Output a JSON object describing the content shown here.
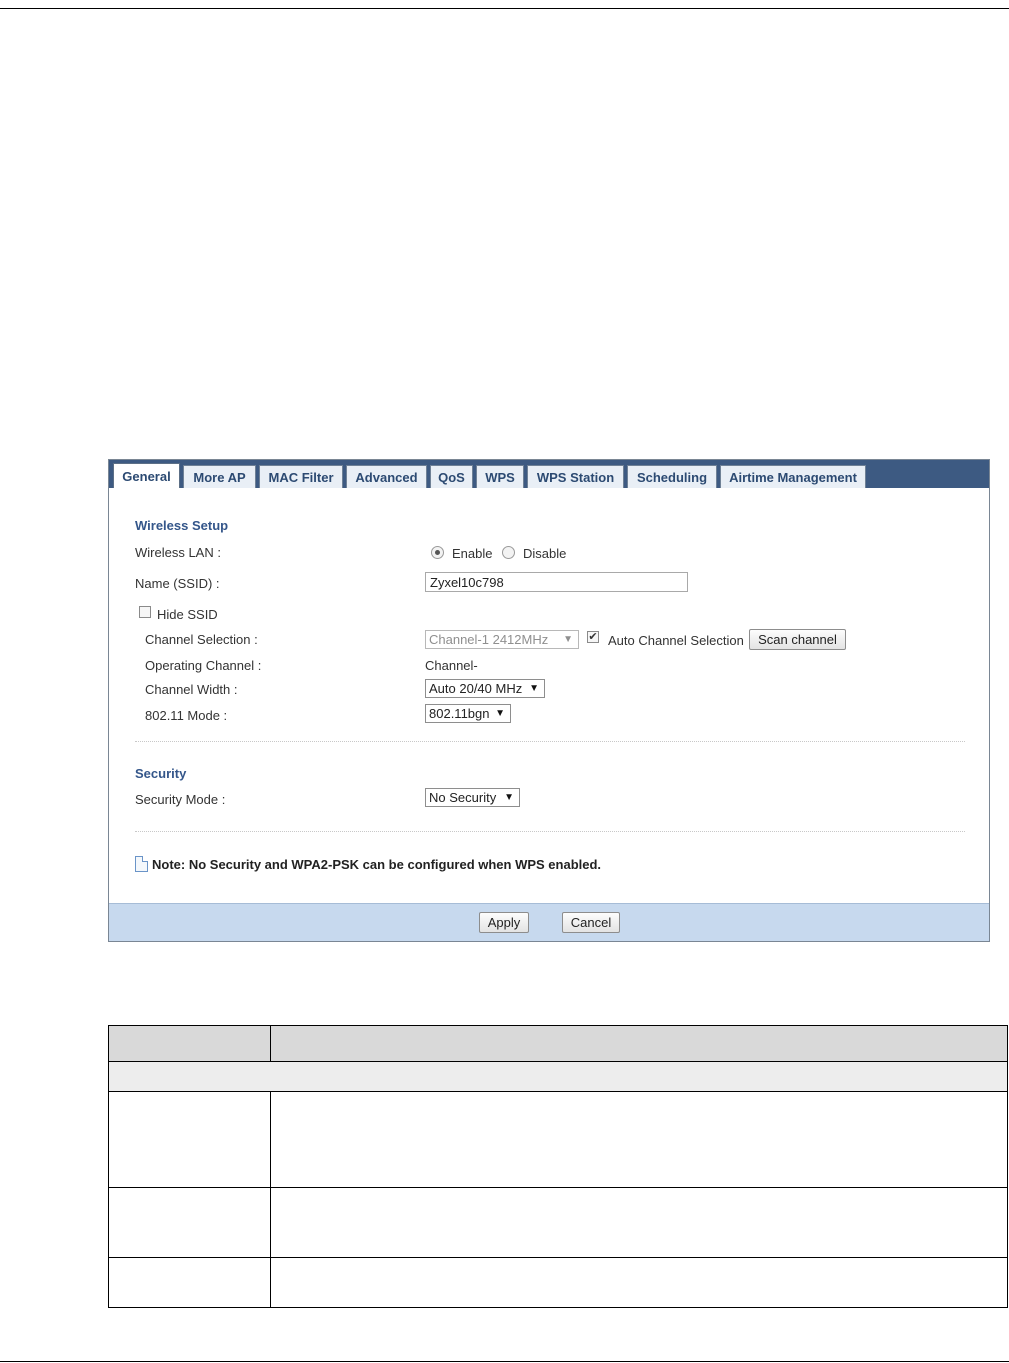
{
  "tabs": [
    {
      "label": "General",
      "active": true
    },
    {
      "label": "More AP",
      "active": false
    },
    {
      "label": "MAC Filter",
      "active": false
    },
    {
      "label": "Advanced",
      "active": false
    },
    {
      "label": "QoS",
      "active": false
    },
    {
      "label": "WPS",
      "active": false
    },
    {
      "label": "WPS Station",
      "active": false
    },
    {
      "label": "Scheduling",
      "active": false
    },
    {
      "label": "Airtime Management",
      "active": false
    }
  ],
  "wireless_setup": {
    "heading": "Wireless Setup",
    "wireless_lan_label": "Wireless LAN :",
    "enable_label": "Enable",
    "disable_label": "Disable",
    "wireless_lan_value": "Enable",
    "ssid_label": "Name (SSID) :",
    "ssid_value": "Zyxel10c798",
    "hide_ssid_label": "Hide SSID",
    "hide_ssid_checked": false,
    "channel_selection_label": "Channel Selection :",
    "channel_selection_value": "Channel-1 2412MHz",
    "channel_selection_disabled": true,
    "auto_channel_label": "Auto Channel Selection",
    "auto_channel_checked": true,
    "scan_channel_label": "Scan channel",
    "operating_channel_label": "Operating Channel :",
    "operating_channel_value": "Channel-",
    "channel_width_label": "Channel Width :",
    "channel_width_value": "Auto 20/40 MHz",
    "mode_label": "802.11 Mode :",
    "mode_value": "802.11bgn"
  },
  "security": {
    "heading": "Security",
    "mode_label": "Security Mode :",
    "mode_value": "No Security"
  },
  "note": "Note: No Security and WPA2-PSK can be configured when WPS enabled.",
  "buttons": {
    "apply": "Apply",
    "cancel": "Cancel"
  },
  "colors": {
    "tab_bar": "#3d5a82",
    "section_heading": "#34568a",
    "footer_bar": "#c7d9ee"
  }
}
